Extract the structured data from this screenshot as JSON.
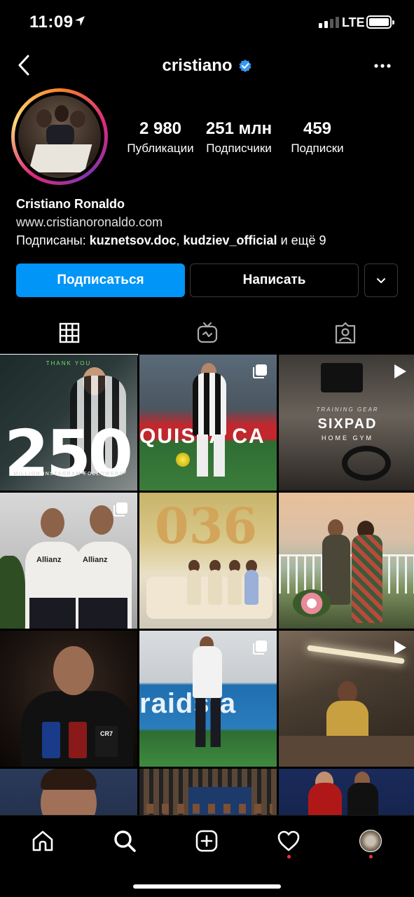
{
  "status_bar": {
    "time": "11:09",
    "network": "LTE",
    "signal_bars": 2,
    "battery_level": 1.0
  },
  "header": {
    "username": "cristiano",
    "verified": true,
    "back_icon": "chevron-left-icon",
    "more_icon": "more-horizontal-icon"
  },
  "profile": {
    "stats": [
      {
        "value": "2 980",
        "label": "Публикации"
      },
      {
        "value": "251 млн",
        "label": "Подписчики"
      },
      {
        "value": "459",
        "label": "Подписки"
      }
    ],
    "full_name": "Cristiano Ronaldo",
    "website": "www.cristianoronaldo.com",
    "followed_by_prefix": "Подписаны:",
    "followed_by_1": "kuznetsov.doc",
    "followed_by_sep": ",",
    "followed_by_2": "kudziev_official",
    "followed_by_suffix": "и ещё 9"
  },
  "actions": {
    "follow_label": "Подписаться",
    "message_label": "Написать",
    "dropdown_icon": "chevron-down-icon"
  },
  "tabs": [
    {
      "icon": "grid-icon",
      "active": true
    },
    {
      "icon": "igtv-icon",
      "active": false
    },
    {
      "icon": "tagged-icon",
      "active": false
    }
  ],
  "posts": {
    "post1": {
      "thank": "THANK YOU",
      "big": "250",
      "sub": "MILLION INSTAGRAM FOLLOWERS"
    },
    "post2": {
      "board": "QUISTA CA",
      "badge": "carousel-icon"
    },
    "post3": {
      "tag": "TRAINING GEAR",
      "brand": "SIXPAD",
      "sub": "HOME GYM",
      "badge": "video-icon"
    },
    "post4": {
      "sponsor1": "Allianz",
      "sponsor2": "Allianz",
      "badge": "carousel-icon"
    },
    "post5": {
      "number": "036"
    },
    "post6": {},
    "post7": {
      "bottle_label": "CR7"
    },
    "post8": {
      "board": "raidsta",
      "badge": "carousel-icon"
    },
    "post9": {
      "badge": "video-icon"
    }
  },
  "colors": {
    "accent": "#0095f6",
    "notification_dot": "#ff3040",
    "background": "#000000"
  },
  "bottom_nav": [
    {
      "icon": "home-icon",
      "dot": false
    },
    {
      "icon": "search-icon",
      "dot": false
    },
    {
      "icon": "add-post-icon",
      "dot": false
    },
    {
      "icon": "heart-icon",
      "dot": true
    },
    {
      "icon": "profile-avatar-icon",
      "dot": true
    }
  ]
}
